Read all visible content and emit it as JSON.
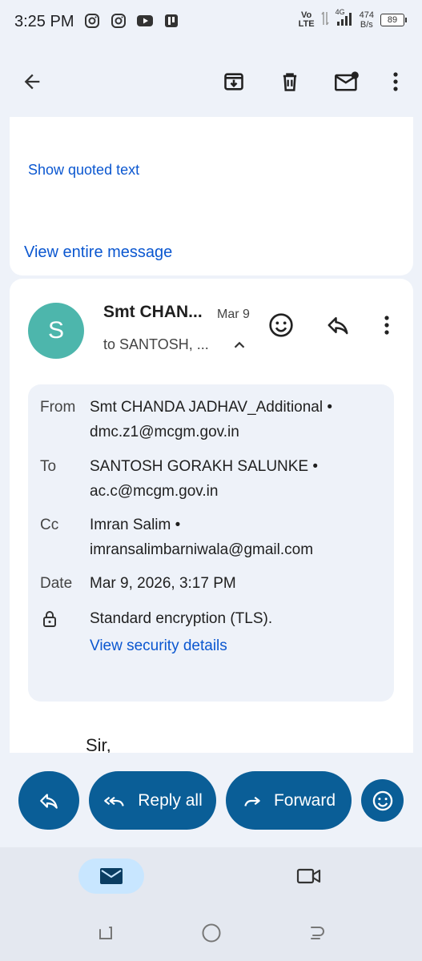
{
  "status_bar": {
    "time": "3:25 PM",
    "volte": "Vo\nLTE",
    "network": "4G",
    "speed_value": "474",
    "speed_unit": "B/s",
    "battery": "89",
    "icons": [
      "instagram-icon",
      "instagram-icon",
      "youtube-icon",
      "app-icon"
    ]
  },
  "toolbar": {
    "icons": [
      "back-arrow-icon",
      "archive-icon",
      "delete-icon",
      "mark-unread-icon",
      "more-vert-icon"
    ]
  },
  "quoted_card": {
    "show_quoted": "Show quoted text",
    "view_entire": "View entire message"
  },
  "message": {
    "avatar_letter": "S",
    "avatar_color": "#4db6ac",
    "sender": "Smt CHAN...",
    "date_short": "Mar 9",
    "to_line": "to SANTOSH, ...",
    "details": {
      "from_label": "From",
      "from_name": "Smt CHANDA JADHAV_Additional •",
      "from_email": "dmc.z1@mcgm.gov.in",
      "to_label": "To",
      "to_name": "SANTOSH GORAKH SALUNKE •",
      "to_email": "ac.c@mcgm.gov.in",
      "cc_label": "Cc",
      "cc_name": "Imran Salim •",
      "cc_email": "imransalimbarniwala@gmail.com",
      "date_label": "Date",
      "date_value": "Mar 9, 2026, 3:17 PM",
      "encryption": "Standard encryption (TLS).",
      "security_link": "View security details"
    },
    "body_start": "Sir,"
  },
  "actions": {
    "reply_all": "Reply all",
    "forward": "Forward"
  },
  "colors": {
    "accent": "#0a5e97",
    "link": "#0b57d0",
    "background": "#eef2f9"
  }
}
